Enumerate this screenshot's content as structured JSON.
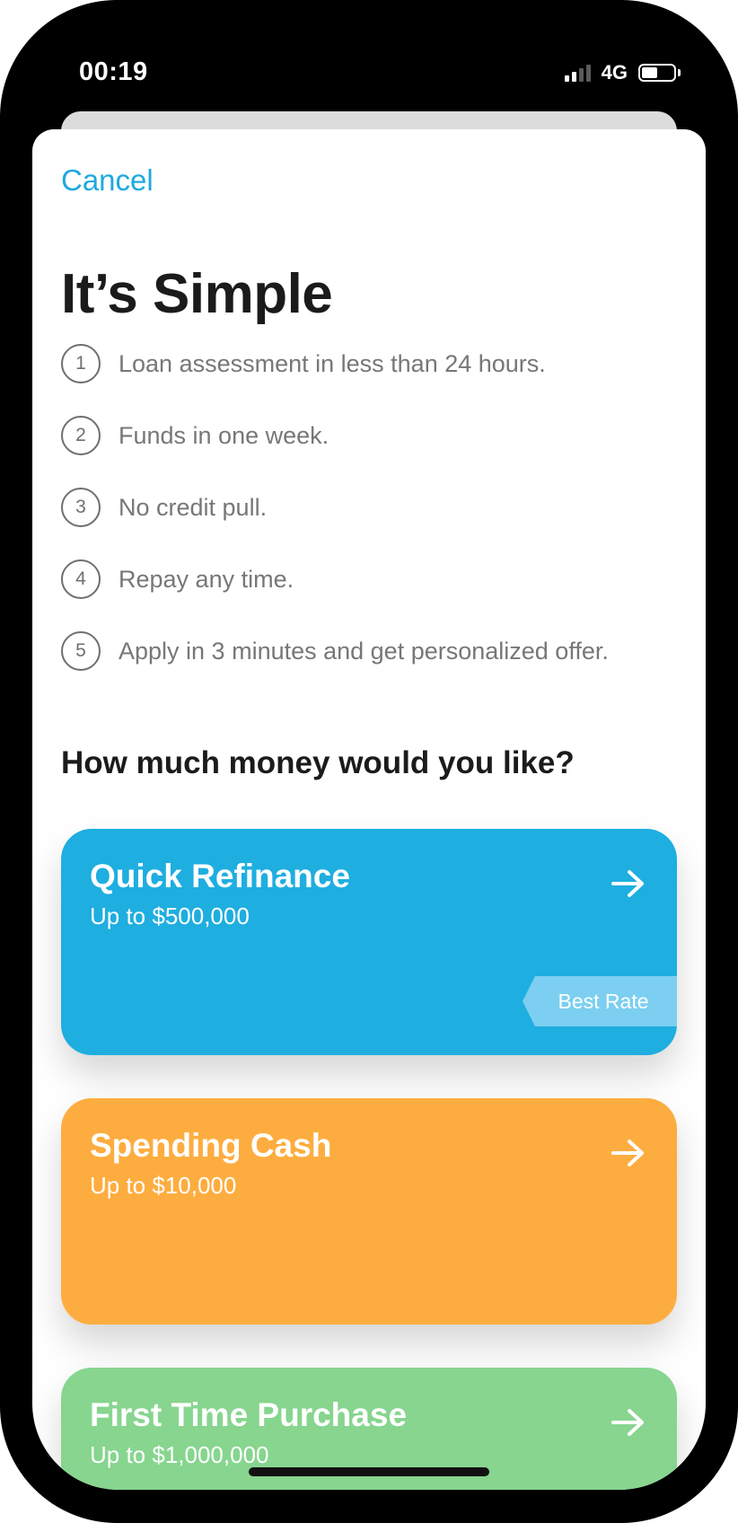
{
  "status_bar": {
    "time": "00:19",
    "network": "4G",
    "signal_bars_active": 2,
    "signal_bars_total": 4,
    "battery_level": 0.5
  },
  "cancel_label": "Cancel",
  "title": "It’s Simple",
  "steps": [
    {
      "number": "1",
      "text": "Loan assessment in less than 24 hours."
    },
    {
      "number": "2",
      "text": "Funds in one week."
    },
    {
      "number": "3",
      "text": "No credit pull."
    },
    {
      "number": "4",
      "text": "Repay any time."
    },
    {
      "number": "5",
      "text": "Apply in 3 minutes and get personalized offer."
    }
  ],
  "question": "How much money would you like?",
  "cards": [
    {
      "title": "Quick Refinance",
      "subtitle": "Up to $500,000",
      "badge": "Best Rate",
      "color": "#1eaee0"
    },
    {
      "title": "Spending Cash",
      "subtitle": "Up to $10,000",
      "color": "#fdad3f"
    },
    {
      "title": "First Time Purchase",
      "subtitle": "Up to $1,000,000",
      "color": "#87d58f"
    }
  ],
  "colors": {
    "accent": "#1ea9df",
    "text_dark": "#1b1b1b",
    "text_muted": "#777777"
  }
}
